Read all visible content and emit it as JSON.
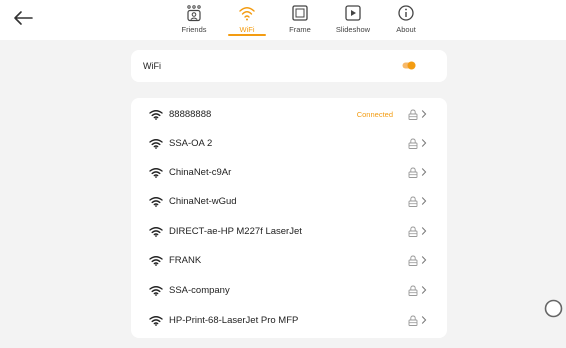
{
  "nav": {
    "back_icon": "arrow-left-icon",
    "tabs": [
      {
        "label": "Friends",
        "icon": "friends-icon",
        "active": false
      },
      {
        "label": "WiFi",
        "icon": "wifi-icon",
        "active": true
      },
      {
        "label": "Frame",
        "icon": "frame-icon",
        "active": false
      },
      {
        "label": "Slideshow",
        "icon": "slideshow-icon",
        "active": false
      },
      {
        "label": "About",
        "icon": "info-icon",
        "active": false
      }
    ]
  },
  "wifi_setting": {
    "label": "WiFi",
    "enabled": true
  },
  "networks": [
    {
      "name": "88888888",
      "status": "Connected",
      "locked": true
    },
    {
      "name": "SSA-OA 2",
      "status": "",
      "locked": true
    },
    {
      "name": "ChinaNet-c9Ar",
      "status": "",
      "locked": true
    },
    {
      "name": "ChinaNet-wGud",
      "status": "",
      "locked": true
    },
    {
      "name": "DIRECT-ae-HP M227f LaserJet",
      "status": "",
      "locked": true
    },
    {
      "name": "FRANK",
      "status": "",
      "locked": true
    },
    {
      "name": "SSA-company",
      "status": "",
      "locked": true
    },
    {
      "name": "HP-Print-68-LaserJet Pro MFP",
      "status": "",
      "locked": true
    }
  ],
  "colors": {
    "accent": "#f39c12",
    "background": "#f3f3f3",
    "card": "#ffffff"
  },
  "floating_button_icon": "assistive-touch-icon"
}
